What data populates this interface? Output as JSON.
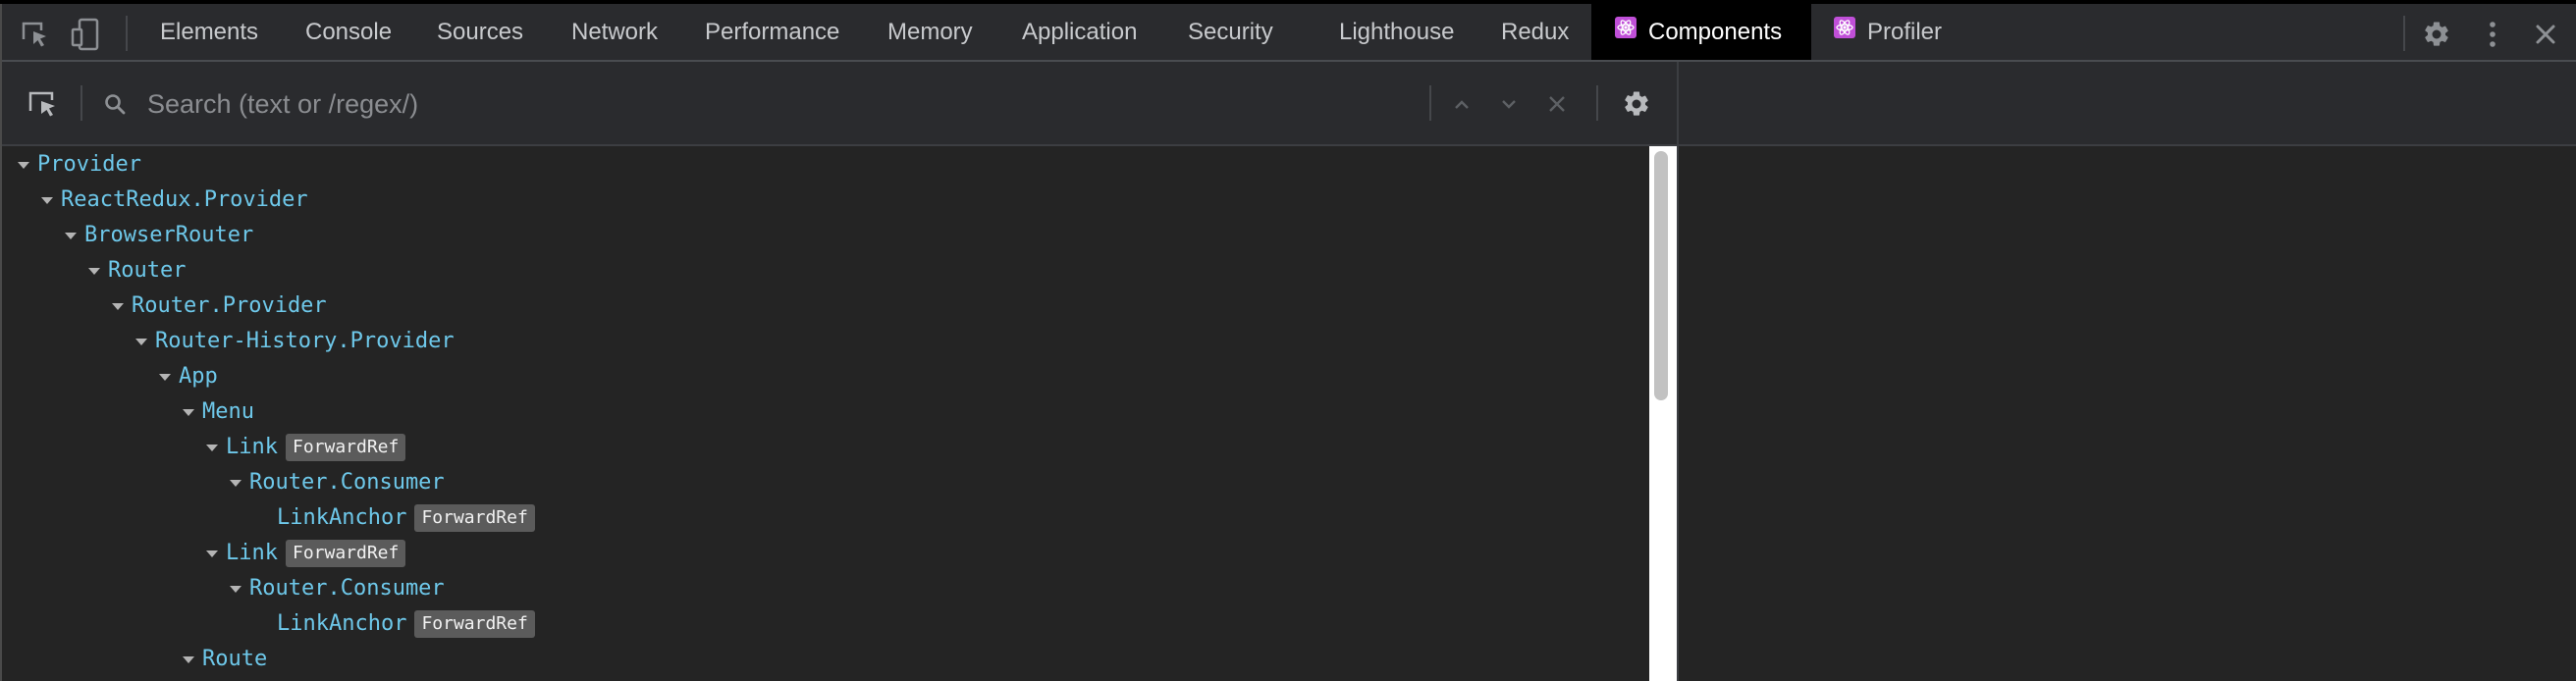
{
  "tabs": [
    {
      "label": "Elements",
      "active": false
    },
    {
      "label": "Console",
      "active": false
    },
    {
      "label": "Sources",
      "active": false
    },
    {
      "label": "Network",
      "active": false
    },
    {
      "label": "Performance",
      "active": false
    },
    {
      "label": "Memory",
      "active": false
    },
    {
      "label": "Application",
      "active": false
    },
    {
      "label": "Security",
      "active": false
    },
    {
      "label": "Lighthouse",
      "active": false
    },
    {
      "label": "Redux",
      "active": false
    },
    {
      "label": "Components",
      "active": true
    },
    {
      "label": "Profiler",
      "active": false
    }
  ],
  "search": {
    "placeholder": "Search (text or /regex/)",
    "value": ""
  },
  "tree": [
    {
      "name": "Provider",
      "badge": "",
      "expanded": true
    },
    {
      "name": "ReactRedux.Provider",
      "badge": "",
      "expanded": true
    },
    {
      "name": "BrowserRouter",
      "badge": "",
      "expanded": true
    },
    {
      "name": "Router",
      "badge": "",
      "expanded": true
    },
    {
      "name": "Router.Provider",
      "badge": "",
      "expanded": true
    },
    {
      "name": "Router-History.Provider",
      "badge": "",
      "expanded": true
    },
    {
      "name": "App",
      "badge": "",
      "expanded": true
    },
    {
      "name": "Menu",
      "badge": "",
      "expanded": true
    },
    {
      "name": "Link",
      "badge": "ForwardRef",
      "expanded": true
    },
    {
      "name": "Router.Consumer",
      "badge": "",
      "expanded": true
    },
    {
      "name": "LinkAnchor",
      "badge": "ForwardRef",
      "expanded": false
    },
    {
      "name": "Link",
      "badge": "ForwardRef",
      "expanded": true
    },
    {
      "name": "Router.Consumer",
      "badge": "",
      "expanded": true
    },
    {
      "name": "LinkAnchor",
      "badge": "ForwardRef",
      "expanded": false
    },
    {
      "name": "Route",
      "badge": "",
      "expanded": true
    }
  ],
  "colors": {
    "component_name": "#6ec8ea",
    "react_icon": "#c04fd8",
    "active_tab_bg": "#000000"
  }
}
